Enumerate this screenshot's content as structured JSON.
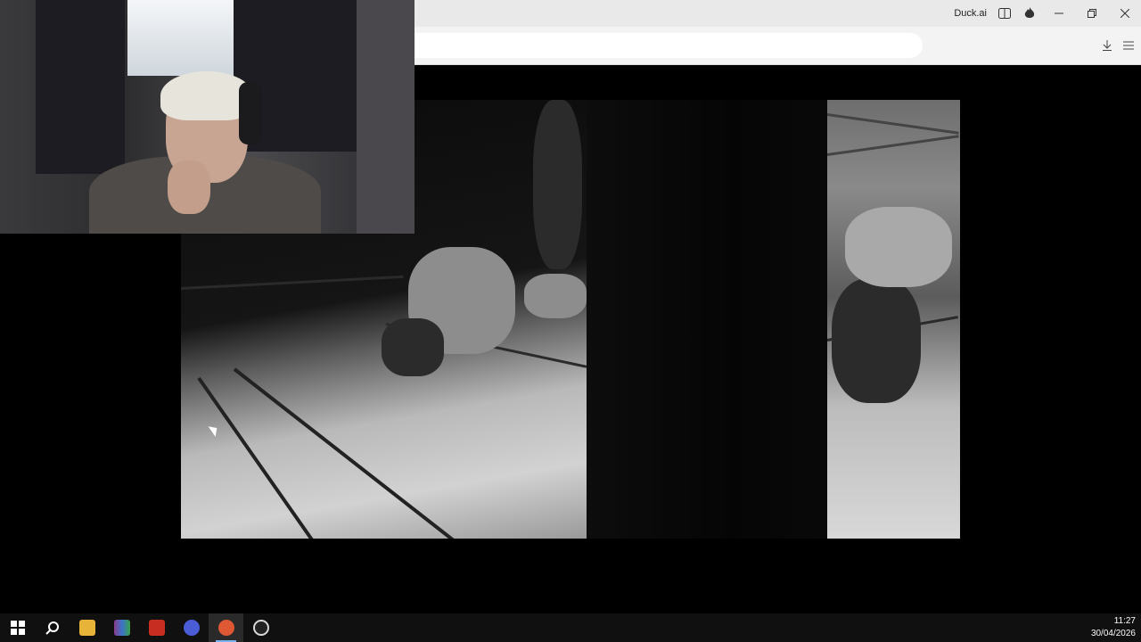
{
  "browser": {
    "tab_label": "Duck.ai",
    "address_value": "",
    "icons": [
      "sidebar-toggle-icon",
      "fire-icon",
      "minimize-icon",
      "restore-icon",
      "close-icon",
      "download-icon",
      "menu-icon"
    ]
  },
  "taskbar": {
    "apps": [
      {
        "name": "start",
        "color": "#ffffff"
      },
      {
        "name": "search",
        "color": "#ffffff"
      },
      {
        "name": "file-explorer",
        "color": "#e8b339"
      },
      {
        "name": "winrar",
        "color": "#8a3d8c"
      },
      {
        "name": "filezilla",
        "color": "#c72d20"
      },
      {
        "name": "opera-gx-app",
        "color": "#4a5cd6"
      },
      {
        "name": "duckduckgo-browser",
        "color": "#de5833"
      },
      {
        "name": "obs-studio",
        "color": "#d8d8d8"
      }
    ],
    "clock_time": "11:27",
    "clock_date": "30/04/2026"
  }
}
